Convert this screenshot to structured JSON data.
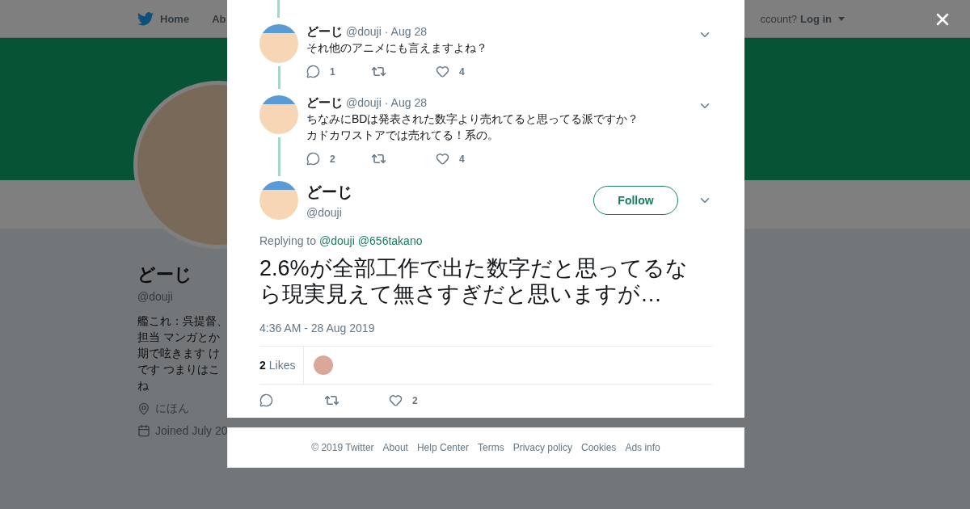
{
  "nav": {
    "home": "Home",
    "about": "Ab",
    "account_prompt": "ccount?",
    "login": "Log in"
  },
  "profile": {
    "name": "どーじ",
    "handle": "@douji",
    "bio": [
      "艦これ：呉提督、",
      "担当 マンガとか",
      "期で呟きます け",
      "です つまりはこ",
      "ね"
    ],
    "location": "にほん",
    "joined": "Joined July 20"
  },
  "thread": [
    {
      "name": "どーじ",
      "handle": "@douji",
      "date": "· Aug 28",
      "text": [
        "それ他のアニメにも言えますよね？"
      ],
      "replies": "1",
      "likes": "4"
    },
    {
      "name": "どーじ",
      "handle": "@douji",
      "date": "· Aug 28",
      "text": [
        "ちなみにBDは発表された数字より売れてると思ってる派ですか？",
        "カドカワストアでは売れてる！系の。"
      ],
      "replies": "2",
      "likes": "4"
    }
  ],
  "tweet": {
    "name": "どーじ",
    "handle": "@douji",
    "follow": "Follow",
    "replying_label": "Replying to",
    "mentions": [
      "@douji",
      "@656takano"
    ],
    "text": "2.6%が全部工作で出た数字だと思ってるなら現実見えて無さすぎだと思いますが…",
    "timestamp": "4:36 AM - 28 Aug 2019",
    "likes_count": "2",
    "likes_label": "Likes",
    "likes": "2"
  },
  "footer": [
    "© 2019 Twitter",
    "About",
    "Help Center",
    "Terms",
    "Privacy policy",
    "Cookies",
    "Ads info"
  ]
}
